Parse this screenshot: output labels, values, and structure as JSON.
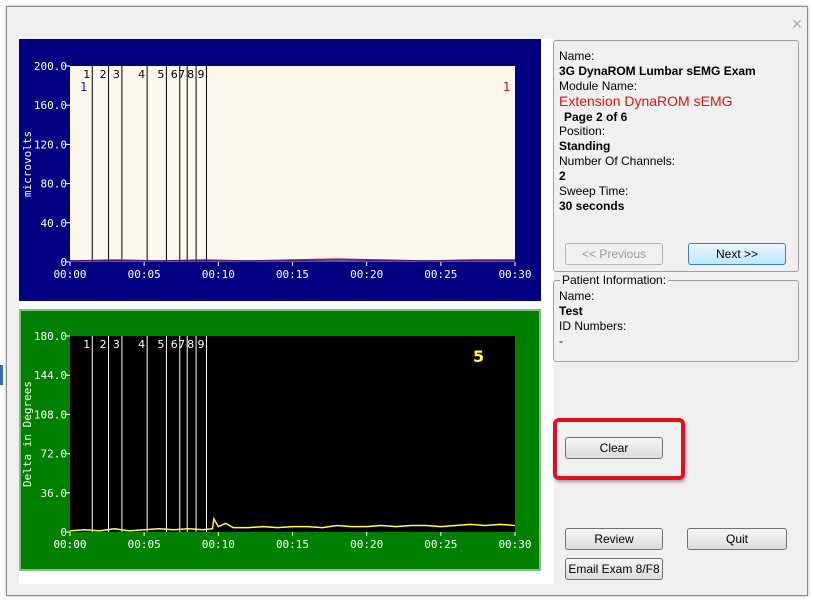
{
  "window": {
    "close_symbol": "✕"
  },
  "chart_data": [
    {
      "type": "line",
      "xlabel": "",
      "ylabel": "microvolts",
      "x_ticks": [
        "00:00",
        "00:05",
        "00:10",
        "00:15",
        "00:20",
        "00:25",
        "00:30"
      ],
      "xlim": [
        0,
        30
      ],
      "y_ticks": [
        "0",
        "40.0",
        "80.0",
        "120.0",
        "160.0",
        "200.0"
      ],
      "ylim": [
        0,
        200
      ],
      "markers": [
        {
          "label": "1",
          "t": 1.5
        },
        {
          "label": "2",
          "t": 2.6
        },
        {
          "label": "3",
          "t": 3.5
        },
        {
          "label": "4",
          "t": 5.2
        },
        {
          "label": "5",
          "t": 6.5
        },
        {
          "label": "6",
          "t": 7.4
        },
        {
          "label": "7",
          "t": 7.9
        },
        {
          "label": "8",
          "t": 8.5
        },
        {
          "label": "9",
          "t": 9.2
        }
      ],
      "channel_labels": [
        {
          "label": "1",
          "color": "#2020d0",
          "position": "left"
        },
        {
          "label": "1",
          "color": "#e01010",
          "position": "right"
        }
      ],
      "series": [
        {
          "color": "#d01010",
          "x": [
            0,
            3,
            6,
            9,
            12,
            15,
            18,
            21,
            24,
            27,
            30
          ],
          "y": [
            1,
            2,
            1,
            2,
            1,
            2,
            3,
            2,
            1,
            2,
            2
          ]
        },
        {
          "color": "#202090",
          "x": [
            0,
            3,
            6,
            9,
            12,
            15,
            18,
            21,
            24,
            27,
            30
          ],
          "y": [
            1,
            1,
            1,
            1,
            1,
            1,
            1,
            1,
            1,
            1,
            1
          ]
        }
      ],
      "colors": {
        "frame": "#000080",
        "plot_bg": "#fdf8ee",
        "axis_text": "#ffffff"
      }
    },
    {
      "type": "line",
      "xlabel": "",
      "ylabel": "Delta in Degrees",
      "x_ticks": [
        "00:00",
        "00:05",
        "00:10",
        "00:15",
        "00:20",
        "00:25",
        "00:30"
      ],
      "xlim": [
        0,
        30
      ],
      "y_ticks": [
        "0",
        "36.0",
        "72.0",
        "108.0",
        "144.0",
        "180.0"
      ],
      "ylim": [
        0,
        180
      ],
      "markers": [
        {
          "label": "1",
          "t": 1.5
        },
        {
          "label": "2",
          "t": 2.6
        },
        {
          "label": "3",
          "t": 3.5
        },
        {
          "label": "4",
          "t": 5.2
        },
        {
          "label": "5",
          "t": 6.5
        },
        {
          "label": "6",
          "t": 7.4
        },
        {
          "label": "7",
          "t": 7.9
        },
        {
          "label": "8",
          "t": 8.5
        },
        {
          "label": "9",
          "t": 9.2
        }
      ],
      "value_label": {
        "text": "5",
        "color": "#ffff40"
      },
      "series": [
        {
          "color": "#ffff40",
          "x": [
            0,
            1,
            2,
            3,
            4,
            5,
            6,
            7,
            8,
            9,
            9.6,
            9.7,
            10,
            10.5,
            11,
            12,
            13,
            14,
            15,
            16,
            17,
            18,
            19,
            20,
            21,
            22,
            23,
            24,
            25,
            26,
            27,
            28,
            29,
            30
          ],
          "y": [
            1,
            2,
            1,
            3,
            1,
            2,
            3,
            2,
            3,
            2,
            3,
            12,
            5,
            8,
            4,
            4,
            5,
            4,
            5,
            5,
            4,
            6,
            5,
            5,
            6,
            5,
            6,
            6,
            5,
            6,
            7,
            6,
            7,
            6
          ]
        }
      ],
      "colors": {
        "frame": "#008000",
        "plot_bg": "#000000",
        "axis_text": "#ffffff"
      }
    }
  ],
  "exam_info": {
    "name_label": "Name:",
    "name_value": "3G DynaROM Lumbar sEMG Exam",
    "module_label": "Module Name:",
    "module_value": "Extension DynaROM sEMG",
    "page": "Page 2 of 6",
    "position_label": "Position:",
    "position_value": "Standing",
    "channels_label": "Number Of Channels:",
    "channels_value": "2",
    "sweep_label": "Sweep Time:",
    "sweep_value": "30 seconds",
    "previous_label": "<< Previous",
    "next_label": "Next >>"
  },
  "patient_info": {
    "group_label": "Patient Information:",
    "name_label": "Name:",
    "name_value": "Test",
    "id_label": "ID Numbers:",
    "id_value": "-"
  },
  "buttons": {
    "clear": "Clear",
    "review": "Review",
    "quit": "Quit",
    "email": "Email Exam 8/F8"
  }
}
